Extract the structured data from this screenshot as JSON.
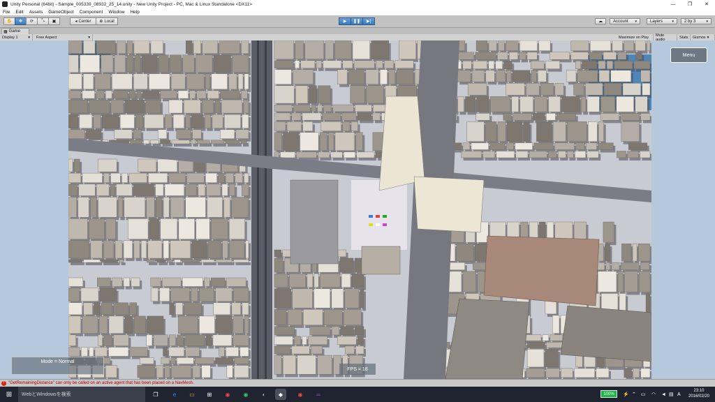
{
  "window": {
    "title": "Unity Personal (64bit) - Sample_005339_08932_25_14.unity - New Unity Project - PC, Mac & Linux Standalone <DX11>",
    "minimize_glyph": "—",
    "maximize_glyph": "❐",
    "close_glyph": "✕"
  },
  "menubar": {
    "items": [
      "File",
      "Edit",
      "Assets",
      "GameObject",
      "Component",
      "Window",
      "Help"
    ]
  },
  "toolbar": {
    "pivot_label": "Center",
    "space_label": "Local",
    "account_label": "Account",
    "layers_label": "Layers",
    "layout_label": "2 by 3"
  },
  "game_view": {
    "tab_label": "Game",
    "display_label": "Display 1",
    "aspect_label": "Free Aspect",
    "maximize_label": "Maximize on Play",
    "mute_label": "Mute audio",
    "stats_label": "Stats",
    "gizmos_label": "Gizmos"
  },
  "overlay": {
    "menu_label": "Menu",
    "mode_text": "Mode = Normal",
    "fps_text": "FPS = 18"
  },
  "console": {
    "error_message": "\"GetRemainingDistance\" can only be called on an active agent that has been placed on a NavMesh."
  },
  "taskbar": {
    "search_placeholder": "WebとWindowsを検索",
    "battery_text": "100%",
    "ime_text": "A",
    "time": "23:10",
    "date": "2016/02/20"
  },
  "colors": {
    "accent": "#3b79b8",
    "error": "#b00000",
    "sky": "#b6c9dc",
    "ground": "#c7c9d1"
  }
}
